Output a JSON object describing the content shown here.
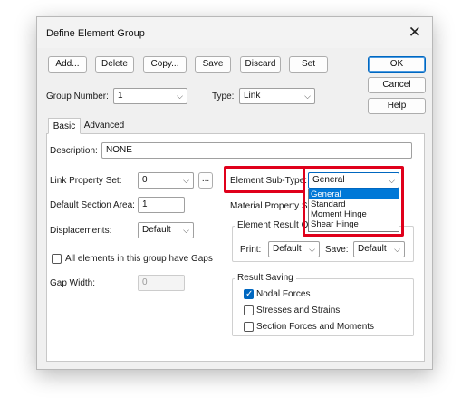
{
  "window": {
    "title": "Define Element Group",
    "close_symbol": "✕"
  },
  "toolbar": {
    "add": "Add...",
    "delete": "Delete",
    "copy": "Copy...",
    "save": "Save",
    "discard": "Discard",
    "set": "Set"
  },
  "side_buttons": {
    "ok": "OK",
    "cancel": "Cancel",
    "help": "Help"
  },
  "group_number": {
    "label": "Group Number:",
    "value": "1"
  },
  "type": {
    "label": "Type:",
    "value": "Link"
  },
  "tabs": [
    {
      "label": "Basic"
    },
    {
      "label": "Advanced"
    }
  ],
  "basic": {
    "description": {
      "label": "Description:",
      "value": "NONE"
    },
    "link_property_set": {
      "label": "Link Property Set:",
      "value": "0",
      "ellipsis": "..."
    },
    "default_section_area": {
      "label": "Default Section Area:",
      "value": "1"
    },
    "displacements": {
      "label": "Displacements:",
      "value": "Default"
    },
    "gaps_checkbox": {
      "label": "All elements in this group have Gaps",
      "checked": false
    },
    "gap_width": {
      "label": "Gap Width:",
      "value": "0"
    },
    "element_sub_type": {
      "label": "Element Sub-Type:",
      "value": "General",
      "options": [
        "General",
        "Standard",
        "Moment Hinge",
        "Shear Hinge"
      ],
      "selected_index": 0
    },
    "material_property": {
      "label": "Material Property S"
    },
    "element_result": {
      "title": "Element Result O",
      "print_label": "Print:",
      "print_value": "Default",
      "save_label": "Save:",
      "save_value": "Default"
    },
    "result_saving": {
      "title": "Result Saving",
      "items": [
        {
          "label": "Nodal Forces",
          "checked": true
        },
        {
          "label": "Stresses and Strains",
          "checked": false
        },
        {
          "label": "Section Forces and Moments",
          "checked": false
        }
      ]
    }
  },
  "chevron": "⌵",
  "check_glyph": "✓",
  "highlight_color": "#e0001b"
}
